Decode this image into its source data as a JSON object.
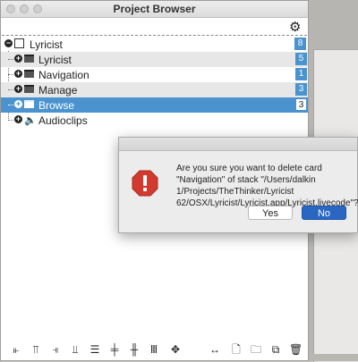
{
  "window": {
    "title": "Project Browser"
  },
  "tree": {
    "stack": {
      "label": "Lyricist",
      "count": "8"
    },
    "cards": [
      {
        "label": "Lyricist",
        "count": "5"
      },
      {
        "label": "Navigation",
        "count": "1"
      },
      {
        "label": "Manage",
        "count": "3"
      },
      {
        "label": "Browse",
        "count": "3"
      },
      {
        "label": "Audioclips",
        "count": ""
      }
    ]
  },
  "dialog": {
    "message": "Are you sure you want to delete card \"Navigation\" of stack \"/Users/dalkin 1/Projects/TheThinker/Lyricist 62/OSX/Lyricist/Lyricist.app/Lyricist.livecode\"?",
    "yes_label": "Yes",
    "no_label": "No"
  },
  "toolbar": {
    "icons": [
      "align-left-icon",
      "align-top-icon",
      "align-right-icon",
      "align-bottom-icon",
      "distribute-vertical-icon",
      "center-vertical-icon",
      "center-horizontal-icon",
      "distribute-horizontal-icon",
      "expand-icon",
      "resize-horizontal-icon",
      "new-file-icon",
      "open-folder-icon",
      "duplicate-icon",
      "trash-icon"
    ]
  },
  "colors": {
    "selection": "#4a93cf",
    "default_button": "#2a67c3",
    "stop_sign": "#d23a2f"
  }
}
